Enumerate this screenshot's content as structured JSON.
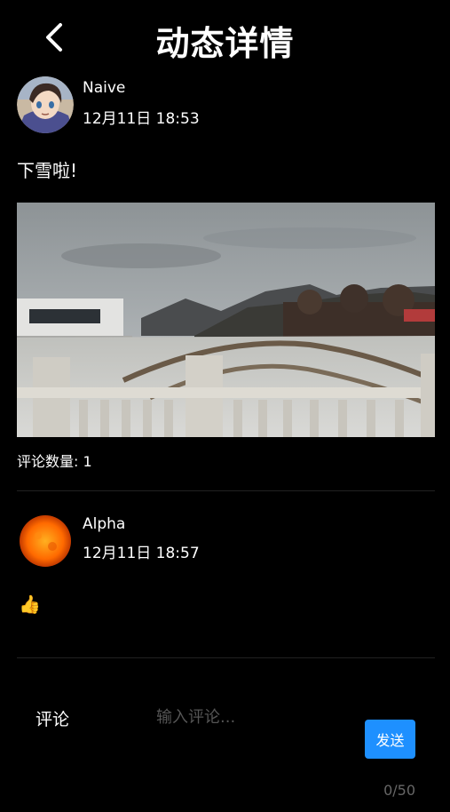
{
  "header": {
    "title": "动态详情",
    "back_icon": "chevron-left-icon"
  },
  "post": {
    "author_name": "Naive",
    "time": "12月11日 18:53",
    "text": "下雪啦!",
    "comment_count_label": "评论数量: 1"
  },
  "comments": [
    {
      "author_name": "Alpha",
      "time": "12月11日 18:57",
      "text": "👍"
    }
  ],
  "composer": {
    "label": "评论",
    "placeholder": "输入评论...",
    "value": "",
    "send_label": "发送",
    "counter": "0/50"
  },
  "colors": {
    "background": "#000000",
    "accent": "#1e90ff",
    "placeholder": "#555555"
  }
}
